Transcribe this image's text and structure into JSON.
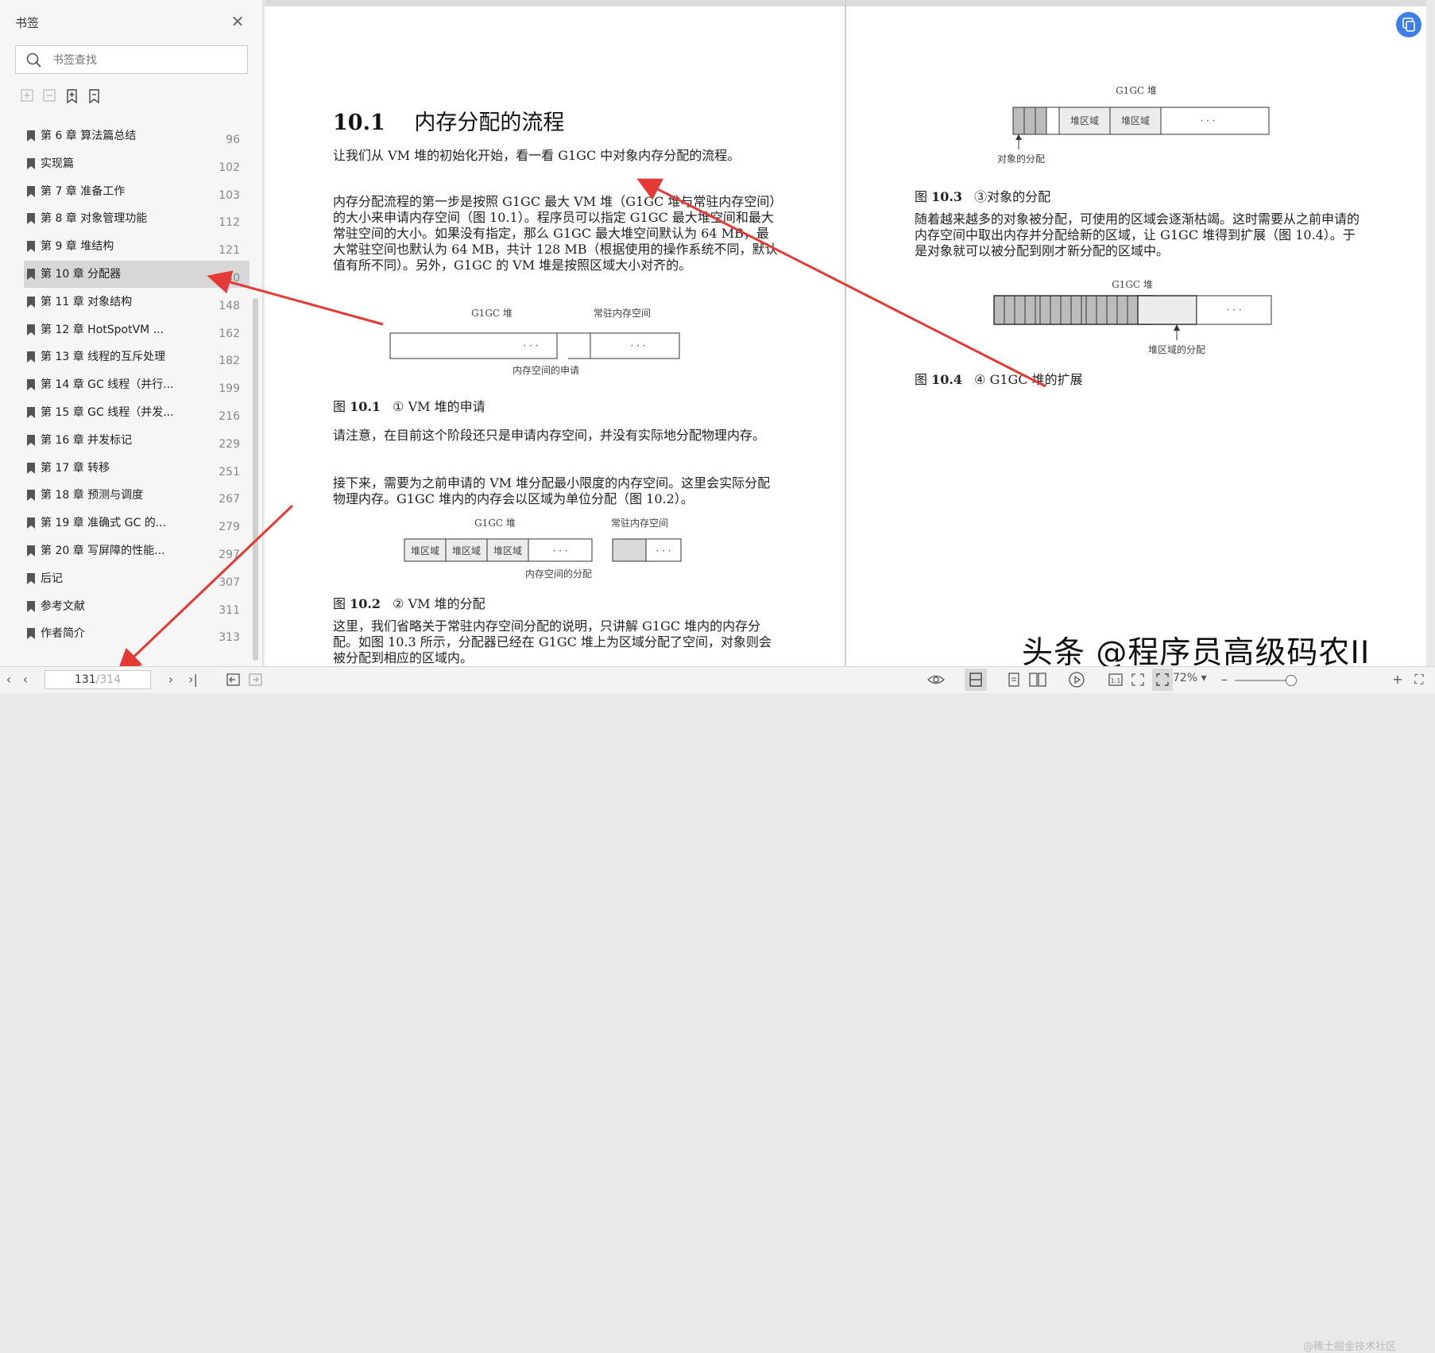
{
  "sidebar": {
    "title": "书签",
    "search_placeholder": "书签查找",
    "items": [
      {
        "label": "第 6 章 算法篇总结",
        "page": "96",
        "selected": false
      },
      {
        "label": "实现篇",
        "page": "102",
        "selected": false
      },
      {
        "label": "第 7 章 准备工作",
        "page": "103",
        "selected": false
      },
      {
        "label": "第 8 章 对象管理功能",
        "page": "112",
        "selected": false
      },
      {
        "label": "第 9 章 堆结构",
        "page": "121",
        "selected": false
      },
      {
        "label": "第 10 章 分配器",
        "page": "130",
        "selected": true
      },
      {
        "label": "第 11 章 对象结构",
        "page": "148",
        "selected": false
      },
      {
        "label": "第 12 章 HotSpotVM ...",
        "page": "162",
        "selected": false
      },
      {
        "label": "第 13 章 线程的互斥处理",
        "page": "182",
        "selected": false
      },
      {
        "label": "第 14 章 GC 线程（并行...",
        "page": "199",
        "selected": false
      },
      {
        "label": "第 15 章 GC 线程（并发...",
        "page": "216",
        "selected": false
      },
      {
        "label": "第 16 章 并发标记",
        "page": "229",
        "selected": false
      },
      {
        "label": "第 17 章 转移",
        "page": "251",
        "selected": false
      },
      {
        "label": "第 18 章 预测与调度",
        "page": "267",
        "selected": false
      },
      {
        "label": "第 19 章 准确式 GC 的...",
        "page": "279",
        "selected": false
      },
      {
        "label": "第 20 章 写屏障的性能...",
        "page": "297",
        "selected": false
      },
      {
        "label": "后记",
        "page": "307",
        "selected": false
      },
      {
        "label": "参考文献",
        "page": "311",
        "selected": false
      },
      {
        "label": "作者简介",
        "page": "313",
        "selected": false
      }
    ]
  },
  "page_left": {
    "heading_num": "10.1",
    "heading_text": "内存分配的流程",
    "p1": "让我们从 VM 堆的初始化开始，看一看 G1GC 中对象内存分配的流程。",
    "p2": "内存分配流程的第一步是按照 G1GC 最大 VM 堆（G1GC 堆与常驻内存空间）的大小来申请内存空间（图 10.1）。程序员可以指定 G1GC 最大堆空间和最大常驻空间的大小。如果没有指定，那么 G1GC 最大堆空间默认为 64 MB，最大常驻空间也默认为 64 MB，共计 128 MB（根据使用的操作系统不同，默认值有所不同）。另外，G1GC 的 VM 堆是按照区域大小对齐的。",
    "fig1": {
      "heap": "G1GC 堆",
      "resident": "常驻内存空间",
      "dots": "· · ·",
      "bottom": "内存空间的申请"
    },
    "cap1_pre": "图 ",
    "cap1_num": "10.1",
    "cap1_text": "① VM 堆的申请",
    "p3": "请注意，在目前这个阶段还只是申请内存空间，并没有实际地分配物理内存。",
    "p4": "接下来，需要为之前申请的 VM 堆分配最小限度的内存空间。这里会实际分配物理内存。G1GC 堆内的内存会以区域为单位分配（图 10.2）。",
    "fig2": {
      "heap": "G1GC 堆",
      "resident": "常驻内存空间",
      "region": "堆区域",
      "dots": "· · ·",
      "bottom": "内存空间的分配"
    },
    "cap2_pre": "图 ",
    "cap2_num": "10.2",
    "cap2_text": "② VM 堆的分配",
    "p5": "这里，我们省略关于常驻内存空间分配的说明，只讲解 G1GC 堆内的内存分配。如图 10.3 所示，分配器已经在 G1GC 堆上为区域分配了空间，对象则会被分配到相应的区域内。"
  },
  "page_right": {
    "fig3": {
      "heap": "G1GC 堆",
      "region": "堆区域",
      "dots": "· · ·",
      "bottom": "对象的分配"
    },
    "cap3_pre": "图 ",
    "cap3_num": "10.3",
    "cap3_text": "③对象的分配",
    "p1": "随着越来越多的对象被分配，可使用的区域会逐渐枯竭。这时需要从之前申请的内存空间中取出内存并分配给新的区域，让 G1GC 堆得到扩展（图 10.4）。于是对象就可以被分配到刚才新分配的区域中。",
    "fig4": {
      "heap": "G1GC 堆",
      "dots": "· · ·",
      "bottom": "堆区域的分配"
    },
    "cap4_pre": "图 ",
    "cap4_num": "10.4",
    "cap4_text": "④ G1GC 堆的扩展"
  },
  "bottombar": {
    "current_page": "131",
    "total_pages": "/314",
    "zoom": "72%"
  },
  "watermark": "头条 @程序员高级码农II",
  "watermark2": "@稀土掘金技术社区",
  "colors": {
    "accent": "#3f7ee8",
    "arrow": "#e53935",
    "selected": "#d7d7d7"
  }
}
